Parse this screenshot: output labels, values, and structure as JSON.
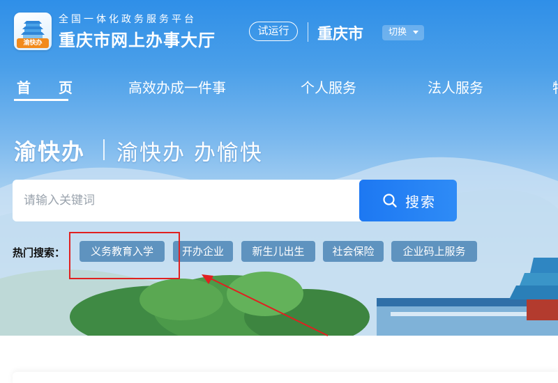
{
  "header": {
    "logo_tag": "渝快办",
    "subtitle": "全国一体化政务服务平台",
    "title": "重庆市网上办事大厅",
    "trial_badge": "试运行",
    "city": "重庆市",
    "switch_label": "切换"
  },
  "nav": {
    "items": [
      {
        "label": "首　页"
      },
      {
        "label": "高效办成一件事"
      },
      {
        "label": "个人服务"
      },
      {
        "label": "法人服务"
      },
      {
        "label": "特"
      }
    ]
  },
  "slogan": {
    "main": "渝快办",
    "sub": "渝快办 办愉快"
  },
  "search": {
    "placeholder": "请输入关键词",
    "button_label": "搜索"
  },
  "hot_search": {
    "label": "热门搜索：",
    "tags": [
      "义务教育入学",
      "开办企业",
      "新生儿出生",
      "社会保险",
      "企业码上服务"
    ]
  },
  "colors": {
    "brand_blue": "#1d78f2",
    "tag_bg": "#5f93bf",
    "annotation_red": "#e02020"
  }
}
